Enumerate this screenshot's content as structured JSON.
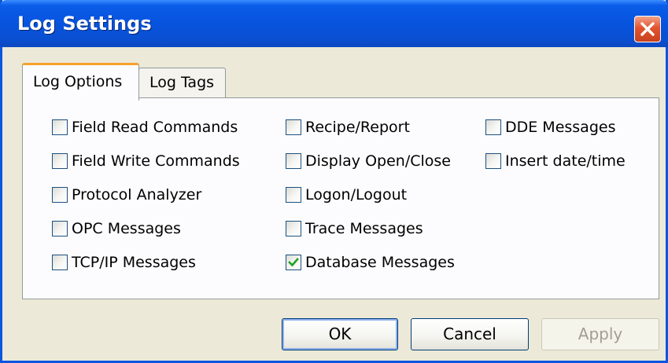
{
  "window": {
    "title": "Log Settings"
  },
  "tabs": [
    {
      "label": "Log Options",
      "active": true
    },
    {
      "label": "Log Tags",
      "active": false
    }
  ],
  "checkboxes": [
    {
      "label": "Field Read Commands",
      "checked": false
    },
    {
      "label": "Field Write Commands",
      "checked": false
    },
    {
      "label": "Protocol Analyzer",
      "checked": false
    },
    {
      "label": "OPC Messages",
      "checked": false
    },
    {
      "label": "TCP/IP Messages",
      "checked": false
    },
    {
      "label": "Recipe/Report",
      "checked": false
    },
    {
      "label": "Display Open/Close",
      "checked": false
    },
    {
      "label": "Logon/Logout",
      "checked": false
    },
    {
      "label": "Trace Messages",
      "checked": false
    },
    {
      "label": "Database Messages",
      "checked": true
    },
    {
      "label": "DDE Messages",
      "checked": false
    },
    {
      "label": "Insert date/time",
      "checked": false
    }
  ],
  "buttons": {
    "ok": "OK",
    "cancel": "Cancel",
    "apply": "Apply"
  },
  "colors": {
    "titlebar": "#0753de",
    "check": "#21a121",
    "tab_accent": "#f5a12b"
  }
}
